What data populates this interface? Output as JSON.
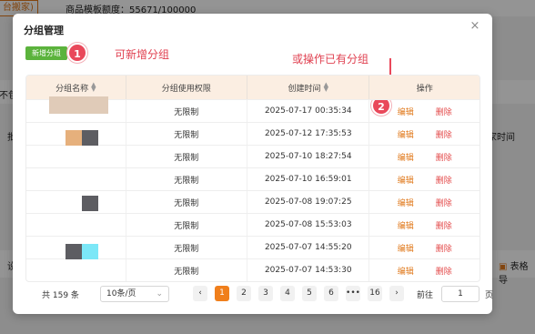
{
  "background": {
    "tag": "台搬家)",
    "quota": "商品模板额度：55671/100000",
    "left_fragment_1": "不包",
    "left_fragment_2": "批",
    "right_fragment": "家时间",
    "bottom_left": "设",
    "bottom_right": "表格导",
    "bottom_icon": "table-icon"
  },
  "modal": {
    "title": "分组管理",
    "close_icon": "×",
    "new_button": "新增分组"
  },
  "annotations": [
    {
      "number": "1",
      "text": "可新增分组"
    },
    {
      "number": "2",
      "text": "或操作已有分组"
    }
  ],
  "table": {
    "columns": [
      "分组名称",
      "分组使用权限",
      "创建时间",
      "操作"
    ],
    "rows": [
      {
        "permission": "无限制",
        "created": "2025-07-17 00:35:34",
        "edit": "编辑",
        "delete": "删除"
      },
      {
        "permission": "无限制",
        "created": "2025-07-12 17:35:53",
        "edit": "编辑",
        "delete": "删除"
      },
      {
        "permission": "无限制",
        "created": "2025-07-10 18:27:54",
        "edit": "编辑",
        "delete": "删除"
      },
      {
        "permission": "无限制",
        "created": "2025-07-10 16:59:01",
        "edit": "编辑",
        "delete": "删除"
      },
      {
        "permission": "无限制",
        "created": "2025-07-08 19:07:25",
        "edit": "编辑",
        "delete": "删除"
      },
      {
        "permission": "无限制",
        "created": "2025-07-08 15:53:03",
        "edit": "编辑",
        "delete": "删除"
      },
      {
        "permission": "无限制",
        "created": "2025-07-07 14:55:20",
        "edit": "编辑",
        "delete": "删除"
      },
      {
        "permission": "无限制",
        "created": "2025-07-07 14:53:30",
        "edit": "编辑",
        "delete": "删除"
      }
    ]
  },
  "pagination": {
    "total": "共 159 条",
    "page_size": "10条/页",
    "prev": "‹",
    "pages": [
      "1",
      "2",
      "3",
      "4",
      "5",
      "6",
      "•••",
      "16"
    ],
    "current": "1",
    "next": "›",
    "goto_label": "前往",
    "goto_value": "1",
    "goto_unit": "页"
  },
  "colors": {
    "accent": "#f07f1c",
    "new_button": "#5bb33c",
    "annotation": "#e9485a",
    "header_bg": "#fbeee2",
    "edit": "#e0781a",
    "delete": "#e34a4a"
  }
}
